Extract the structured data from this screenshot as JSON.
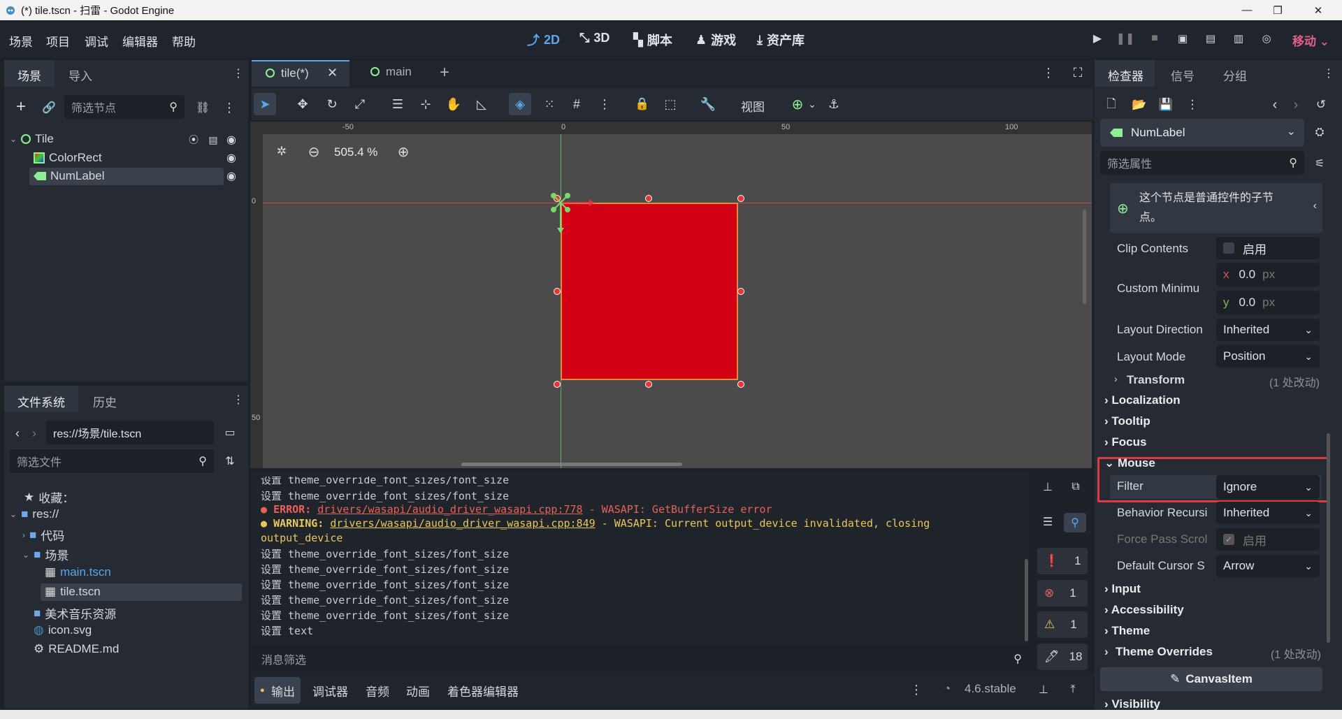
{
  "window": {
    "title": "(*) tile.tscn - 扫雷 - Godot Engine"
  },
  "menu": [
    "场景",
    "项目",
    "调试",
    "编辑器",
    "帮助"
  ],
  "workspaces": [
    {
      "label": "2D",
      "icon": "2d-icon",
      "active": true
    },
    {
      "label": "3D",
      "icon": "3d-icon",
      "active": false
    },
    {
      "label": "脚本",
      "icon": "script-icon",
      "active": false
    },
    {
      "label": "游戏",
      "icon": "game-icon",
      "active": false
    },
    {
      "label": "资产库",
      "icon": "asset-lib-icon",
      "active": false
    }
  ],
  "renderer": "移动",
  "scene_dock": {
    "tabs": [
      "场景",
      "导入"
    ],
    "filter_placeholder": "筛选节点",
    "nodes": [
      {
        "name": "Tile",
        "icon": "control-node-icon"
      },
      {
        "name": "ColorRect",
        "icon": "colorrect-icon"
      },
      {
        "name": "NumLabel",
        "icon": "label-icon",
        "selected": true
      }
    ]
  },
  "fs_dock": {
    "tabs": [
      "文件系统",
      "历史"
    ],
    "path": "res://场景/tile.tscn",
    "filter_placeholder": "筛选文件",
    "items": [
      {
        "label": "收藏：",
        "icon": "star-icon"
      },
      {
        "label": "res://",
        "icon": "folder-icon"
      },
      {
        "label": "代码",
        "icon": "folder-icon"
      },
      {
        "label": "场景",
        "icon": "folder-icon"
      },
      {
        "label": "main.tscn",
        "icon": "scene-file-icon"
      },
      {
        "label": "tile.tscn",
        "icon": "scene-file-icon",
        "selected": true
      },
      {
        "label": "美术音乐资源",
        "icon": "folder-icon"
      },
      {
        "label": "icon.svg",
        "icon": "godot-icon"
      },
      {
        "label": "README.md",
        "icon": "gear-icon"
      }
    ]
  },
  "editor_tabs": [
    {
      "label": "tile(*)",
      "active": true
    },
    {
      "label": "main",
      "active": false
    }
  ],
  "toolbar": {
    "view_label": "视图"
  },
  "viewport": {
    "zoom": "505.4 %",
    "ruler_labels": [
      "-50",
      "0",
      "50",
      "100"
    ],
    "vruler_labels": [
      "0",
      "50"
    ],
    "rect_color": "#d10014"
  },
  "output": {
    "lines": [
      {
        "text": "设置 theme_override_font_sizes/font_size",
        "type": "normal"
      },
      {
        "text": "设置 theme_override_font_sizes/font_size",
        "type": "normal"
      },
      {
        "prefix": "ERROR:",
        "link": "drivers/wasapi/audio_driver_wasapi.cpp:778",
        "rest": " - WASAPI: GetBufferSize error",
        "type": "error"
      },
      {
        "prefix": "WARNING:",
        "link": "drivers/wasapi/audio_driver_wasapi.cpp:849",
        "rest": " - WASAPI: Current output_device invalidated, closing",
        "type": "warning"
      },
      {
        "text": "output_device",
        "type": "warning-cont"
      },
      {
        "text": "设置 theme_override_font_sizes/font_size",
        "type": "normal"
      },
      {
        "text": "设置 theme_override_font_sizes/font_size",
        "type": "normal"
      },
      {
        "text": "设置 theme_override_font_sizes/font_size",
        "type": "normal"
      },
      {
        "text": "设置 theme_override_font_sizes/font_size",
        "type": "normal"
      },
      {
        "text": "设置 theme_override_font_sizes/font_size",
        "type": "normal"
      },
      {
        "text": "设置 text",
        "type": "normal"
      }
    ],
    "filter_placeholder": "消息筛选",
    "counters": [
      {
        "icon": "message-icon",
        "value": "1"
      },
      {
        "icon": "error-icon",
        "value": "1"
      },
      {
        "icon": "warning-icon",
        "value": "1"
      },
      {
        "icon": "editor-msg-icon",
        "value": "18"
      }
    ]
  },
  "bottom_tabs": [
    "输出",
    "调试器",
    "音频",
    "动画",
    "着色器编辑器"
  ],
  "version": "4.6.stable",
  "inspector": {
    "tabs": [
      "检查器",
      "信号",
      "分组"
    ],
    "node_name": "NumLabel",
    "filter_placeholder": "筛选属性",
    "info_text": "这个节点是普通控件的子节点。",
    "clip_contents": {
      "label": "Clip Contents",
      "value": "启用"
    },
    "custom_min": {
      "label": "Custom Minimu",
      "x": "0.0",
      "y": "0.0",
      "unit": "px",
      "x_axis": "x",
      "y_axis": "y"
    },
    "layout_direction": {
      "label": "Layout Direction",
      "value": "Inherited"
    },
    "layout_mode": {
      "label": "Layout Mode",
      "value": "Position"
    },
    "transform": {
      "label": "Transform",
      "note": "(1 处改动)"
    },
    "sections": [
      "Localization",
      "Tooltip",
      "Focus"
    ],
    "mouse": {
      "label": "Mouse"
    },
    "filter": {
      "label": "Filter",
      "value": "Ignore"
    },
    "behavior": {
      "label": "Behavior Recursi",
      "value": "Inherited"
    },
    "force_pass": {
      "label": "Force Pass Scrol",
      "value": "启用"
    },
    "cursor": {
      "label": "Default Cursor S",
      "value": "Arrow"
    },
    "sections2": [
      "Input",
      "Accessibility",
      "Theme"
    ],
    "theme_overrides": {
      "label": "Theme Overrides",
      "note": "(1 处改动)"
    },
    "canvas_item": "CanvasItem",
    "visibility": "Visibility"
  }
}
